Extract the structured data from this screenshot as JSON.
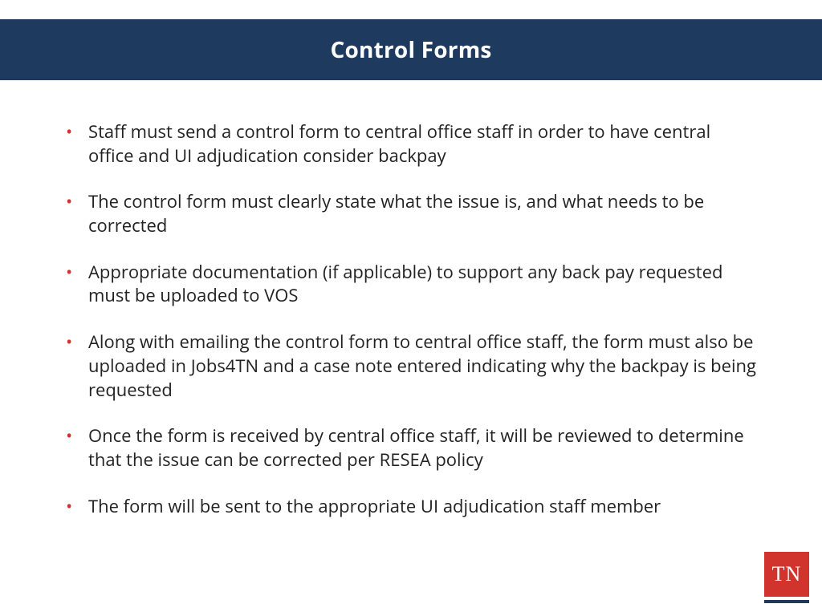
{
  "header": {
    "title": "Control Forms"
  },
  "bullets": [
    "Staff must send a control form to central office staff in order to have central office and UI adjudication consider backpay",
    "The control form must clearly state what the issue is, and what needs to be corrected",
    "Appropriate documentation  (if applicable) to support any back pay requested must be uploaded to VOS",
    "Along with emailing the control form to central office staff, the form must also be uploaded in Jobs4TN and a case note entered indicating why the backpay is being requested",
    "Once the form is received by central office staff, it will be reviewed to determine that the issue can be corrected per RESEA policy",
    "The form will be sent to the appropriate UI adjudication staff member"
  ],
  "logo": {
    "text": "TN"
  }
}
